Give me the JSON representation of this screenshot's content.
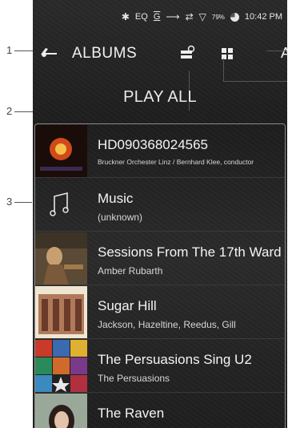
{
  "callouts": [
    "1",
    "2",
    "3"
  ],
  "status": {
    "eq": "EQ",
    "gapless": "G",
    "battery": "79%",
    "time": "10:42 PM"
  },
  "header": {
    "title": "ALBUMS",
    "sort_label": "Al"
  },
  "play_all": "PLAY ALL",
  "albums": [
    {
      "title": "HD090368024565",
      "artist": "Bruckner Orchester Linz / Bernhard Klee, conductor"
    },
    {
      "title": "Music",
      "artist": "(unknown)"
    },
    {
      "title": "Sessions From The 17th Ward",
      "artist": "Amber Rubarth"
    },
    {
      "title": "Sugar Hill",
      "artist": "Jackson, Hazeltine, Reedus, Gill"
    },
    {
      "title": "The Persuasions Sing U2",
      "artist": "The Persuasions"
    },
    {
      "title": "The Raven",
      "artist": ""
    }
  ],
  "colors": {
    "background": "#1e1e1e",
    "text": "#f4f4f4",
    "border": "#8a8a8a"
  }
}
